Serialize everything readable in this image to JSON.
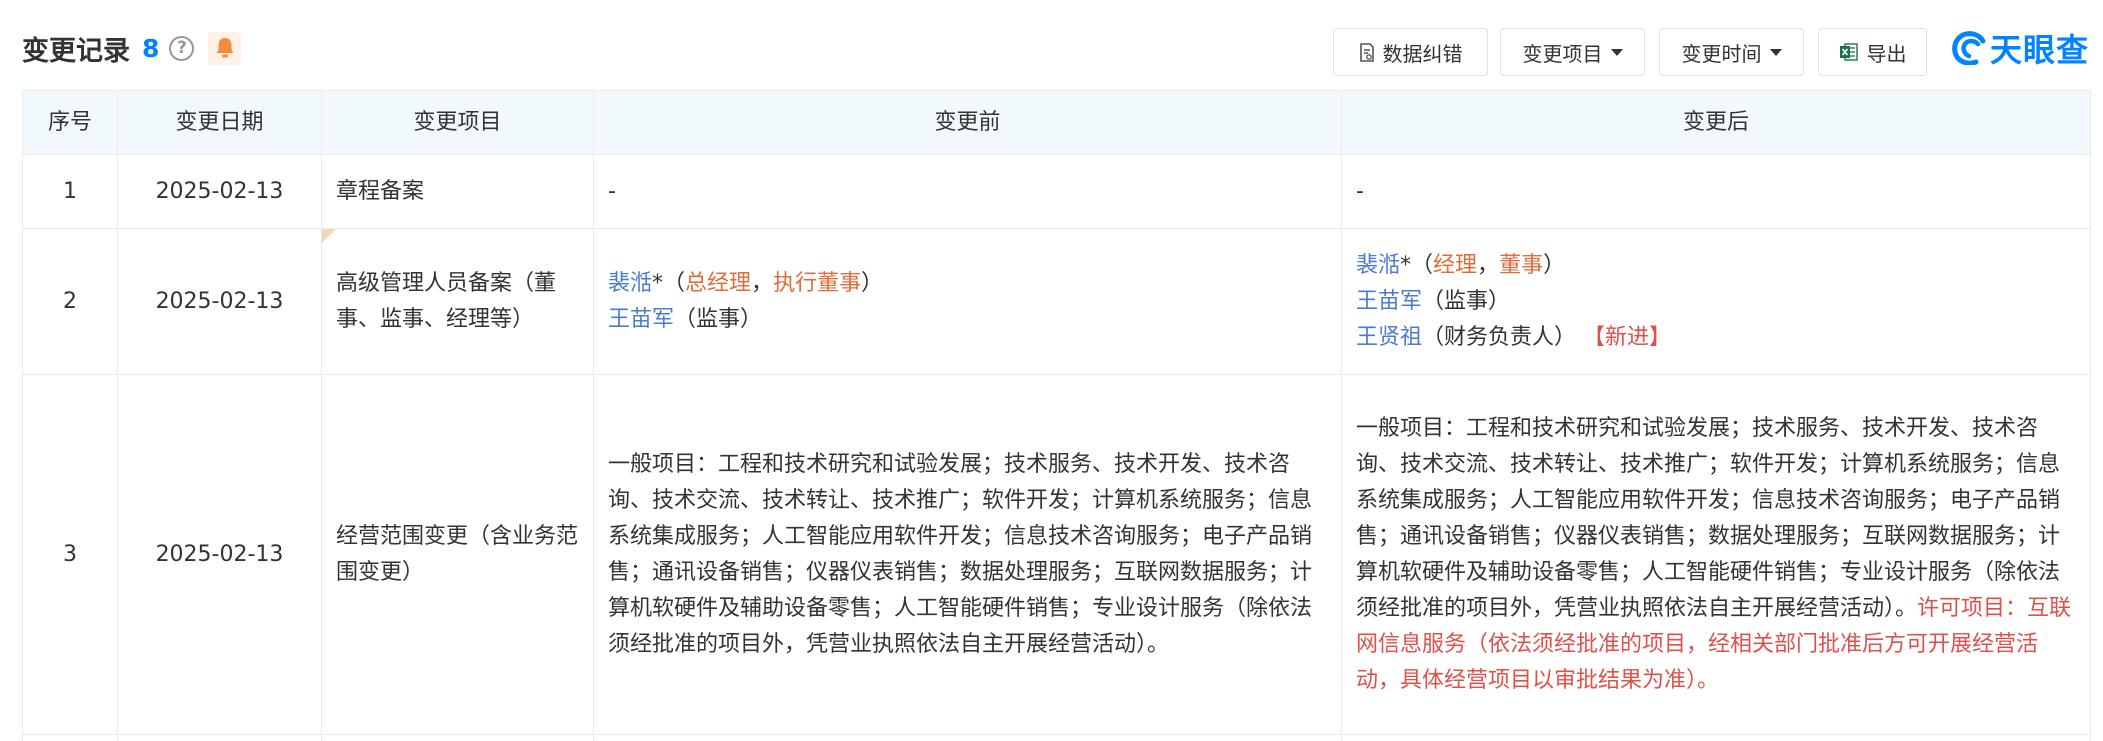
{
  "header": {
    "title": "变更记录",
    "count": "8",
    "help_symbol": "?",
    "buttons": {
      "data_correction": "数据纠错",
      "change_item": "变更项目",
      "change_time": "变更时间",
      "export": "导出"
    },
    "logo_text": "天眼查"
  },
  "colors": {
    "accent": "#0084ff",
    "link": "#4a7bd4",
    "role": "#e06c3c",
    "highlight": "#e0504a",
    "header_bg": "#f2f9fc",
    "bell_bg": "#fff1e6",
    "bell": "#f08c3c"
  },
  "icons": [
    "help-icon",
    "bell-icon",
    "document-icon",
    "excel-icon",
    "tianyancha-logo-icon"
  ],
  "table": {
    "columns": [
      "序号",
      "变更日期",
      "变更项目",
      "变更前",
      "变更后"
    ],
    "rows": [
      {
        "index": "1",
        "date": "2025-02-13",
        "item": "章程备案",
        "before": "-",
        "after": "-"
      },
      {
        "index": "2",
        "date": "2025-02-13",
        "item": "高级管理人员备案（董事、监事、经理等）",
        "before": {
          "p1_name": "裴湉",
          "p1_star": "*",
          "p1_open": "（",
          "p1_role1": "总经理",
          "p1_sep": "，",
          "p1_role2": "执行董事",
          "p1_close": "）",
          "p2_name": "王苗军",
          "p2_role": "（监事）"
        },
        "after": {
          "p1_name": "裴湉",
          "p1_star": "*",
          "p1_open": "（",
          "p1_role1": "经理",
          "p1_sep": "，",
          "p1_role2": "董事",
          "p1_close": "）",
          "p2_name": "王苗军",
          "p2_role": "（监事）",
          "p3_name": "王贤祖",
          "p3_role": "（财务负责人）",
          "p3_tag": "【新进】"
        }
      },
      {
        "index": "3",
        "date": "2025-02-13",
        "item": "经营范围变更（含业务范围变更）",
        "before": "一般项目：工程和技术研究和试验发展；技术服务、技术开发、技术咨询、技术交流、技术转让、技术推广；软件开发；计算机系统服务；信息系统集成服务；人工智能应用软件开发；信息技术咨询服务；电子产品销售；通讯设备销售；仪器仪表销售；数据处理服务；互联网数据服务；计算机软硬件及辅助设备零售；人工智能硬件销售；专业设计服务（除依法须经批准的项目外，凭营业执照依法自主开展经营活动）。",
        "after_normal": "一般项目：工程和技术研究和试验发展；技术服务、技术开发、技术咨询、技术交流、技术转让、技术推广；软件开发；计算机系统服务；信息系统集成服务；人工智能应用软件开发；信息技术咨询服务；电子产品销售；通讯设备销售；仪器仪表销售；数据处理服务；互联网数据服务；计算机软硬件及辅助设备零售；人工智能硬件销售；专业设计服务（除依法须经批准的项目外，凭营业执照依法自主开展经营活动）。",
        "after_highlight": "许可项目：互联网信息服务（依法须经批准的项目，经相关部门批准后方可开展经营活动，具体经营项目以审批结果为准）。"
      }
    ]
  }
}
